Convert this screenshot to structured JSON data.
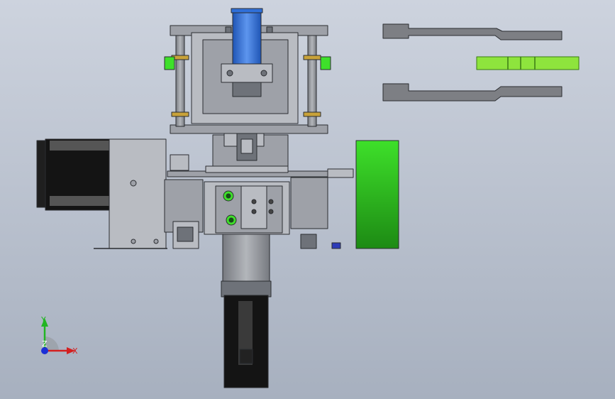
{
  "viewport": {
    "background_top": "#cdd3de",
    "background_bottom": "#a7b0bf"
  },
  "triad": {
    "y_label": "Y",
    "x_label": "X",
    "z_label": "Z",
    "y_color": "#22b522",
    "x_color": "#d42020",
    "z_color": "#1c2fd6"
  },
  "colors": {
    "steel_light": "#b9bcc2",
    "steel_mid": "#9ea1a8",
    "steel_dark": "#6e7279",
    "edge": "#2b2d31",
    "motor_black": "#141414",
    "cylinder_blue": "#2f6fd8",
    "accent_green": "#3ee02a",
    "accent_green_dark": "#1d8a14",
    "brass": "#c8a23a",
    "arm_gray": "#7d7f84",
    "arm_green": "#8ee43d"
  },
  "icons": {
    "coordinate_triad": "coordinate-triad-icon"
  }
}
